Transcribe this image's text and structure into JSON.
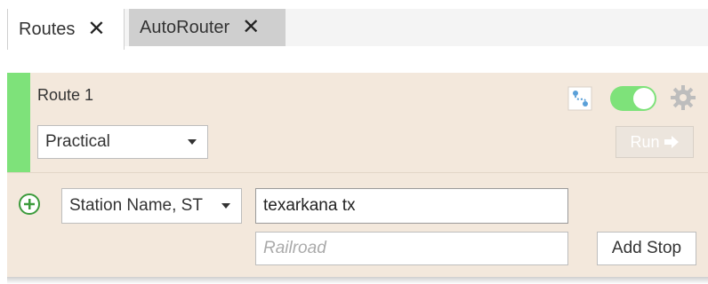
{
  "tabs": [
    {
      "label": "Routes",
      "active": true,
      "close_glyph": "✕"
    },
    {
      "label": "AutoRouter",
      "active": false,
      "close_glyph": "✕"
    }
  ],
  "route": {
    "title": "Route 1",
    "profile_selected": "Practical",
    "enabled": true,
    "run_label": "Run",
    "run_icon": "arrow-right-icon",
    "accent_color": "#7ee27a",
    "panel_color": "#f3e8dc"
  },
  "stop": {
    "type_selected": "Station Name, ST",
    "search_value": "texarkana tx",
    "railroad_placeholder": "Railroad",
    "add_stop_label": "Add Stop",
    "add_icon": "add-circle-icon"
  }
}
